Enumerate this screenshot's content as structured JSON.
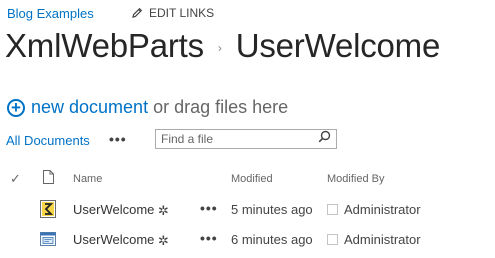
{
  "top_nav": {
    "site_link": "Blog Examples",
    "edit_links": "EDIT LINKS"
  },
  "breadcrumb": {
    "library": "XmlWebParts",
    "separator": "›",
    "folder": "UserWelcome"
  },
  "actions": {
    "new_document": "new document",
    "drag_text": "or drag files here"
  },
  "view": {
    "current": "All Documents",
    "more": "•••"
  },
  "search": {
    "placeholder": "Find a file"
  },
  "table": {
    "headers": {
      "check": "✓",
      "name": "Name",
      "modified": "Modified",
      "modified_by": "Modified By"
    },
    "rows": [
      {
        "icon": "xml-file-icon",
        "name": "UserWelcome",
        "new_marker": "✲",
        "menu": "•••",
        "modified": "5 minutes ago",
        "modified_by": "Administrator"
      },
      {
        "icon": "webpart-file-icon",
        "name": "UserWelcome",
        "new_marker": "✲",
        "menu": "•••",
        "modified": "6 minutes ago",
        "modified_by": "Administrator"
      }
    ]
  },
  "colors": {
    "link": "#0072c6",
    "new_marker": "#3a9b35",
    "text": "#444444"
  }
}
